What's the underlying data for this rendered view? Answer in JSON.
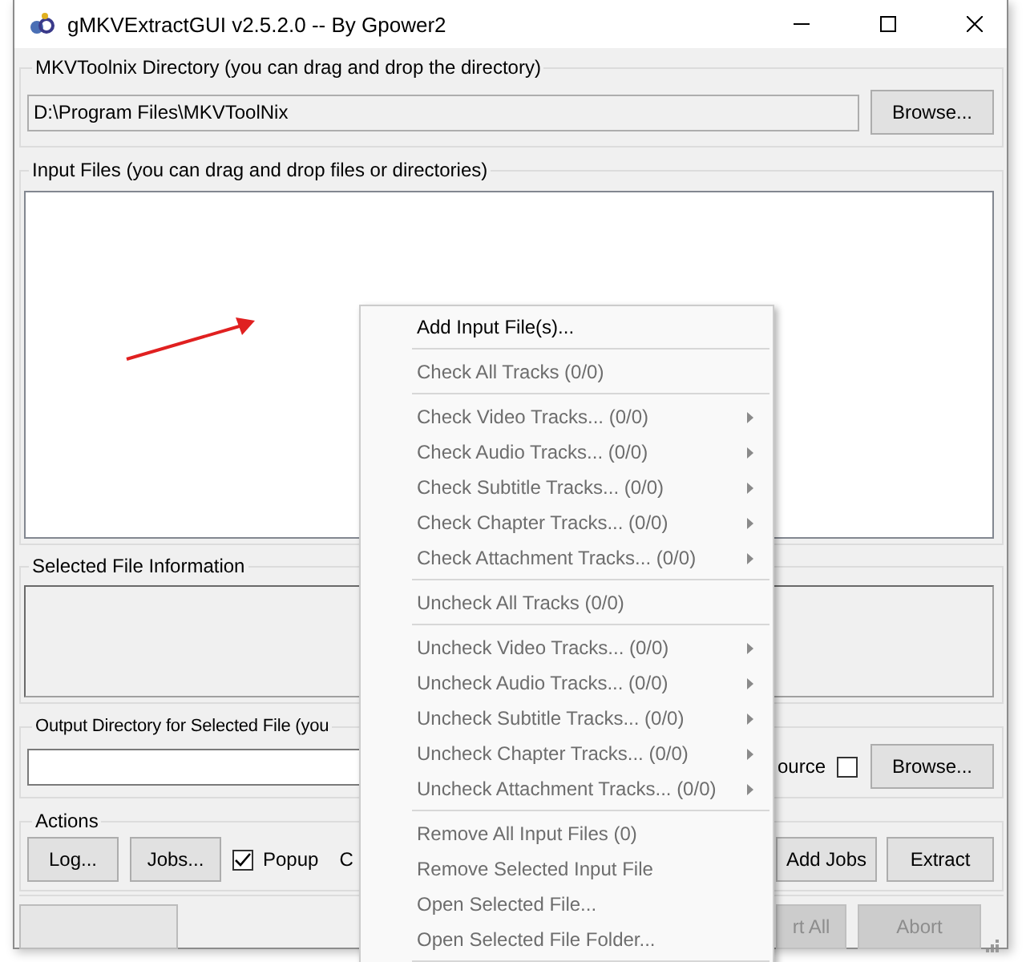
{
  "window": {
    "title": "gMKVExtractGUI v2.5.2.0 -- By Gpower2"
  },
  "mkvtoolnix": {
    "label": "MKVToolnix Directory (you can drag and drop the directory)",
    "value": "D:\\Program Files\\MKVToolNix",
    "button": "Browse..."
  },
  "input_files": {
    "label": "Input Files (you can drag and drop files or directories)"
  },
  "selected_file_info": {
    "label": "Selected File Information"
  },
  "output": {
    "label": "Output Directory for Selected File (you",
    "checkbox_label": "ource",
    "checked": false,
    "button": "Browse..."
  },
  "actions": {
    "label": "Actions",
    "buttons": [
      "Log...",
      "Jobs..."
    ],
    "popup": {
      "label": "Popup",
      "checked": true
    },
    "cut_label": "C",
    "right_buttons": [
      "Add Jobs",
      "Extract"
    ]
  },
  "status_bar": {
    "progress": {
      "level": 0
    },
    "buttons": [
      {
        "label": "rt All",
        "disabled": true
      },
      {
        "label": "Abort",
        "disabled": true
      }
    ]
  },
  "context_menu": {
    "items": [
      {
        "kind": "item",
        "label": "Add Input File(s)...",
        "disabled": false,
        "submenu": false
      },
      {
        "kind": "separator"
      },
      {
        "kind": "item",
        "label": "Check All Tracks (0/0)",
        "disabled": true,
        "submenu": false
      },
      {
        "kind": "separator"
      },
      {
        "kind": "item",
        "label": "Check Video Tracks... (0/0)",
        "disabled": true,
        "submenu": true
      },
      {
        "kind": "item",
        "label": "Check Audio Tracks... (0/0)",
        "disabled": true,
        "submenu": true
      },
      {
        "kind": "item",
        "label": "Check Subtitle Tracks... (0/0)",
        "disabled": true,
        "submenu": true
      },
      {
        "kind": "item",
        "label": "Check Chapter Tracks... (0/0)",
        "disabled": true,
        "submenu": true
      },
      {
        "kind": "item",
        "label": "Check Attachment Tracks... (0/0)",
        "disabled": true,
        "submenu": true
      },
      {
        "kind": "separator"
      },
      {
        "kind": "item",
        "label": "Uncheck All Tracks (0/0)",
        "disabled": true,
        "submenu": false
      },
      {
        "kind": "separator"
      },
      {
        "kind": "item",
        "label": "Uncheck Video Tracks... (0/0)",
        "disabled": true,
        "submenu": true
      },
      {
        "kind": "item",
        "label": "Uncheck Audio Tracks... (0/0)",
        "disabled": true,
        "submenu": true
      },
      {
        "kind": "item",
        "label": "Uncheck Subtitle Tracks... (0/0)",
        "disabled": true,
        "submenu": true
      },
      {
        "kind": "item",
        "label": "Uncheck Chapter Tracks... (0/0)",
        "disabled": true,
        "submenu": true
      },
      {
        "kind": "item",
        "label": "Uncheck Attachment Tracks... (0/0)",
        "disabled": true,
        "submenu": true
      },
      {
        "kind": "separator"
      },
      {
        "kind": "item",
        "label": "Remove All Input Files (0)",
        "disabled": true,
        "submenu": false
      },
      {
        "kind": "item",
        "label": "Remove Selected Input File",
        "disabled": true,
        "submenu": false
      },
      {
        "kind": "item",
        "label": "Open Selected File...",
        "disabled": true,
        "submenu": false
      },
      {
        "kind": "item",
        "label": "Open Selected File Folder...",
        "disabled": true,
        "submenu": false
      },
      {
        "kind": "separator"
      }
    ]
  }
}
